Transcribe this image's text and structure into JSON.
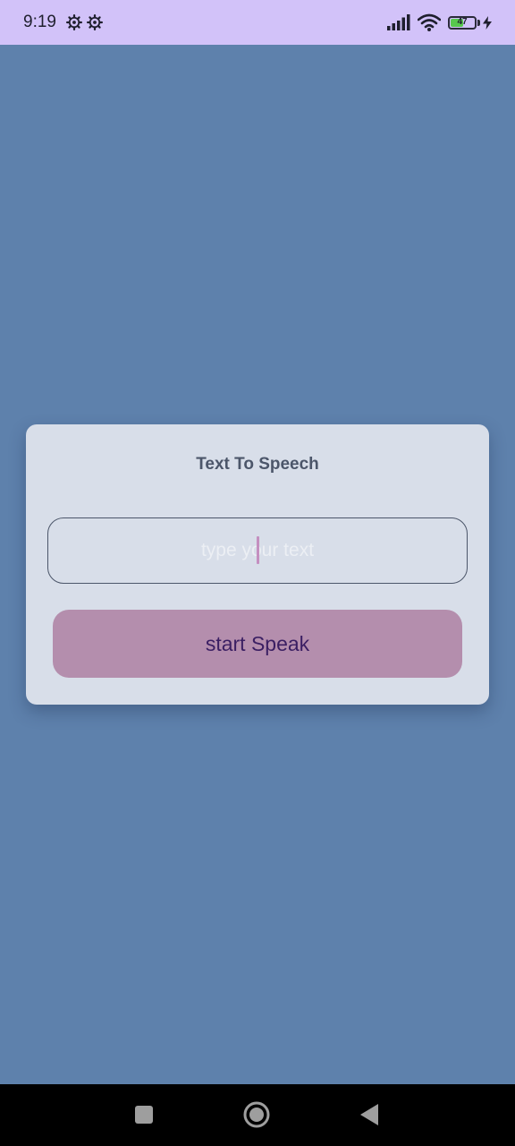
{
  "status_bar": {
    "time": "9:19",
    "battery_level": "47",
    "icons": [
      "settings-gear-icon",
      "settings-gear-icon",
      "signal-icon",
      "wifi-icon",
      "battery-icon",
      "charging-bolt-icon"
    ]
  },
  "card": {
    "title": "Text To Speech",
    "input": {
      "value": "",
      "placeholder": "type your text"
    },
    "speak_button_label": "start Speak"
  },
  "nav_bar": {
    "buttons": [
      "recent-apps-icon",
      "home-icon",
      "back-icon"
    ]
  },
  "colors": {
    "background": "#5e81ac",
    "status_bar": "#d2c2f9",
    "card": "#d8dee9",
    "title_text": "#4c566a",
    "button": "#b48ead",
    "button_text": "#3b1f63",
    "nav_bar": "#000000"
  }
}
